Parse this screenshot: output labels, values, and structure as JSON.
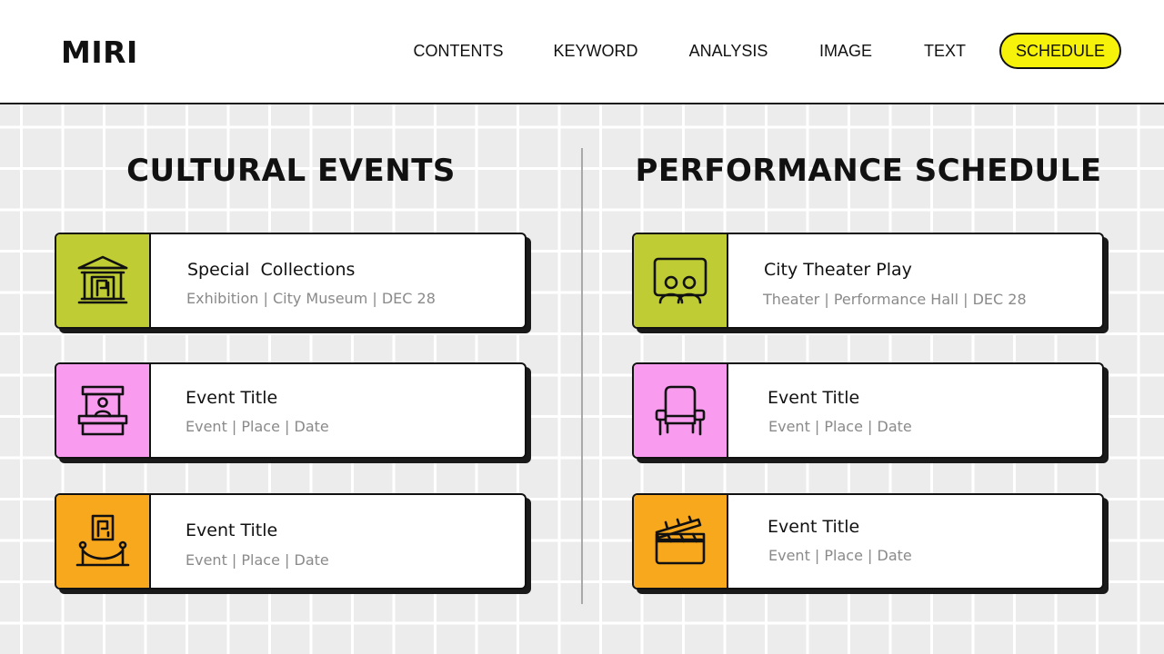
{
  "brand": "MIRI",
  "nav": {
    "items": [
      "CONTENTS",
      "KEYWORD",
      "ANALYSIS",
      "IMAGE",
      "TEXT",
      "SCHEDULE"
    ],
    "active": "SCHEDULE",
    "active_color": "#f7f20a"
  },
  "cultural": {
    "title": "CULTURAL EVENTS",
    "cards": [
      {
        "title": "Special  Collections",
        "subtitle": "Exhibition | City Museum | DEC 28",
        "icon": "museum-icon",
        "color": "#bfcc34"
      },
      {
        "title": "Event Title",
        "subtitle": "Event | Place | Date",
        "icon": "ticket-booth-icon",
        "color": "#f99cef"
      },
      {
        "title": "Event Title",
        "subtitle": "Event | Place | Date",
        "icon": "gallery-rope-icon",
        "color": "#f8a81c"
      }
    ]
  },
  "performance": {
    "title": "PERFORMANCE SCHEDULE",
    "cards": [
      {
        "title": "City Theater Play",
        "subtitle": "Theater | Performance Hall | DEC 28",
        "icon": "audience-screen-icon",
        "color": "#bfcc34"
      },
      {
        "title": "Event Title",
        "subtitle": "Event | Place | Date",
        "icon": "theater-seat-icon",
        "color": "#f99cef"
      },
      {
        "title": "Event Title",
        "subtitle": "Event | Place | Date",
        "icon": "clapperboard-icon",
        "color": "#f8a81c"
      }
    ]
  }
}
